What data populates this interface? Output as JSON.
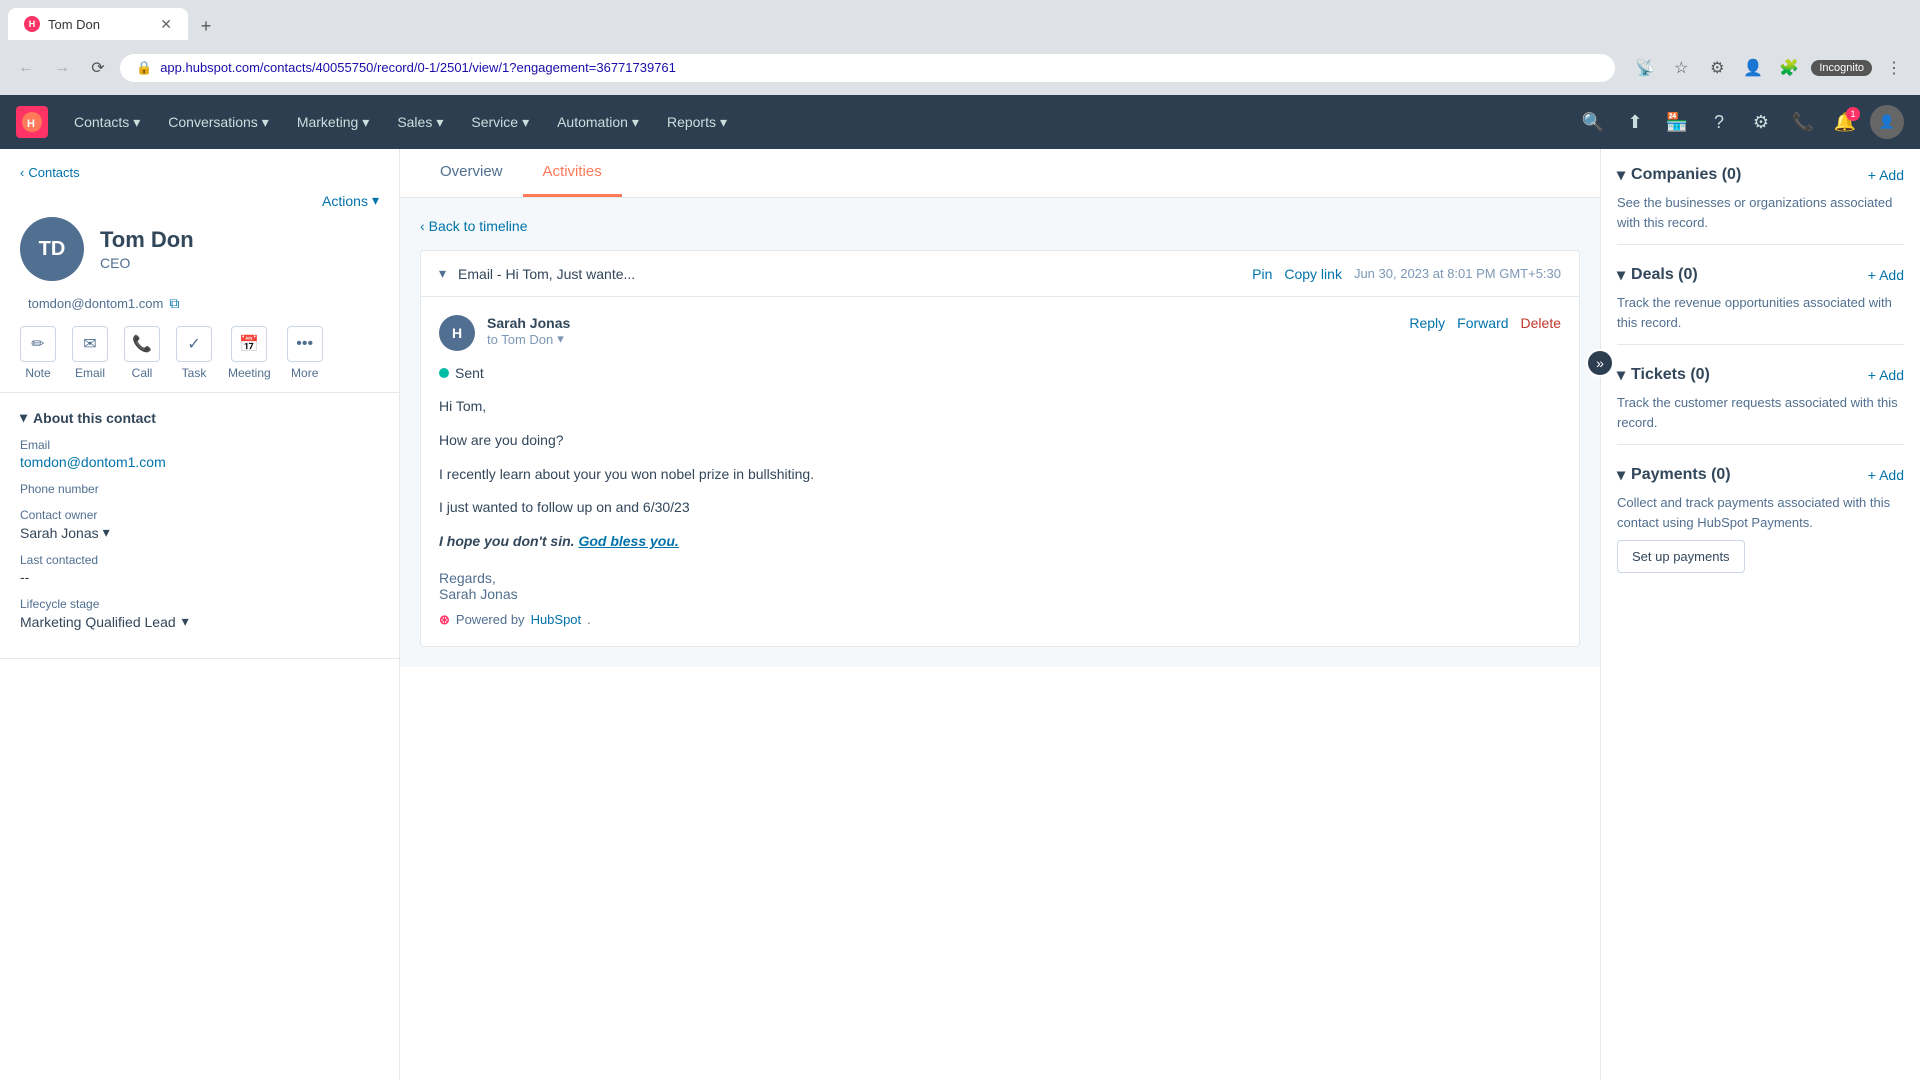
{
  "browser": {
    "tab_title": "Tom Don",
    "url": "app.hubspot.com/contacts/40055750/record/0-1/2501/view/1?engagement=36771739761",
    "new_tab_label": "+",
    "incognito_label": "Incognito"
  },
  "top_nav": {
    "logo_text": "H",
    "items": [
      {
        "label": "Contacts",
        "id": "contacts"
      },
      {
        "label": "Conversations",
        "id": "conversations"
      },
      {
        "label": "Marketing",
        "id": "marketing"
      },
      {
        "label": "Sales",
        "id": "sales"
      },
      {
        "label": "Service",
        "id": "service"
      },
      {
        "label": "Automation",
        "id": "automation"
      },
      {
        "label": "Reports",
        "id": "reports"
      }
    ],
    "notification_count": "1"
  },
  "sidebar": {
    "back_label": "Contacts",
    "actions_label": "Actions",
    "contact": {
      "initials": "TD",
      "name": "Tom Don",
      "title": "CEO",
      "email": "tomdon@dontom1.com"
    },
    "action_buttons": [
      {
        "label": "Note",
        "icon": "✏️",
        "id": "note"
      },
      {
        "label": "Email",
        "icon": "✉️",
        "id": "email"
      },
      {
        "label": "Call",
        "icon": "📞",
        "id": "call"
      },
      {
        "label": "Task",
        "icon": "✓",
        "id": "task"
      },
      {
        "label": "Meeting",
        "icon": "📅",
        "id": "meeting"
      },
      {
        "label": "More",
        "icon": "•••",
        "id": "more"
      }
    ],
    "about_section": {
      "title": "About this contact",
      "fields": [
        {
          "label": "Email",
          "value": "tomdon@dontom1.com",
          "type": "email"
        },
        {
          "label": "Phone number",
          "value": "",
          "type": "empty"
        },
        {
          "label": "Contact owner",
          "value": "Sarah Jonas",
          "type": "owner"
        },
        {
          "label": "Last contacted",
          "value": "--",
          "type": "text"
        },
        {
          "label": "Lifecycle stage",
          "value": "Marketing Qualified Lead",
          "type": "badge"
        }
      ]
    }
  },
  "main": {
    "tabs": [
      {
        "label": "Overview",
        "id": "overview",
        "active": false
      },
      {
        "label": "Activities",
        "id": "activities",
        "active": true
      }
    ],
    "back_to_timeline": "Back to timeline",
    "email": {
      "subject": "Email - Hi Tom, Just wante...",
      "pin_label": "Pin",
      "copy_link_label": "Copy link",
      "timestamp": "Jun 30, 2023 at 8:01 PM GMT+5:30",
      "sender": "Sarah Jonas",
      "sender_initials": "H",
      "to_label": "to Tom Don",
      "reply_label": "Reply",
      "forward_label": "Forward",
      "delete_label": "Delete",
      "status": "Sent",
      "greeting": "Hi Tom,",
      "paragraph1": "How are you doing?",
      "paragraph2": "I recently learn about your you won nobel prize in bullshiting.",
      "paragraph3": "I just wanted to follow up on  and 6/30/23",
      "paragraph4_plain": "I hope you don't sin. ",
      "paragraph4_link": "God bless you.",
      "regards_label": "Regards,",
      "signature_name": "Sarah Jonas",
      "powered_by_label": "Powered by",
      "hubspot_link": "HubSpot",
      "powered_by_dot": "."
    }
  },
  "right_panel": {
    "sections": [
      {
        "id": "companies",
        "title": "Companies (0)",
        "add_label": "+ Add",
        "description": "See the businesses or organizations associated with this record."
      },
      {
        "id": "deals",
        "title": "Deals (0)",
        "add_label": "+ Add",
        "description": "Track the revenue opportunities associated with this record."
      },
      {
        "id": "tickets",
        "title": "Tickets (0)",
        "add_label": "+ Add",
        "description": "Track the customer requests associated with this record."
      },
      {
        "id": "payments",
        "title": "Payments (0)",
        "add_label": "+ Add",
        "description": "Collect and track payments associated with this contact using HubSpot Payments.",
        "button_label": "Set up payments"
      }
    ]
  }
}
